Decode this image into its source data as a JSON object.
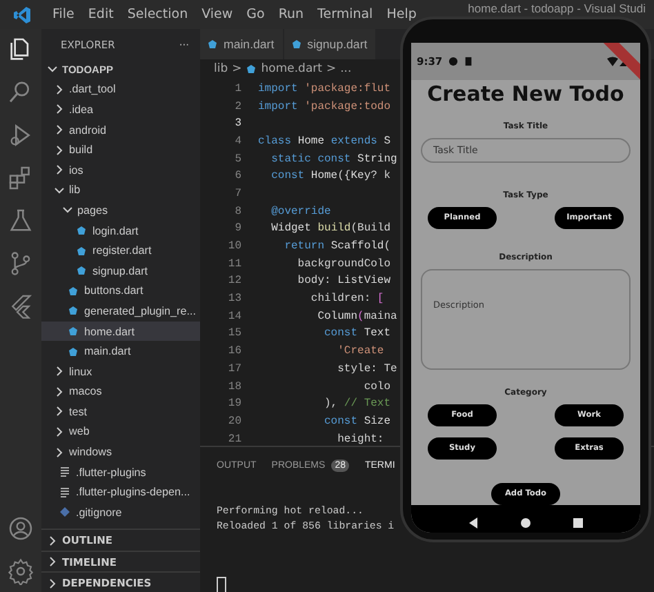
{
  "window": {
    "title": "home.dart - todoapp - Visual Studi"
  },
  "menu": [
    "File",
    "Edit",
    "Selection",
    "View",
    "Go",
    "Run",
    "Terminal",
    "Help"
  ],
  "activity_bar": [
    {
      "kind": "files",
      "selected": true
    },
    {
      "kind": "search",
      "selected": false
    },
    {
      "kind": "run",
      "selected": false
    },
    {
      "kind": "extensions",
      "selected": false
    },
    {
      "kind": "testing",
      "selected": false
    },
    {
      "kind": "source-control",
      "selected": false
    },
    {
      "kind": "flutter",
      "selected": false
    }
  ],
  "activity_bar_bottom": [
    {
      "kind": "account"
    },
    {
      "kind": "settings"
    }
  ],
  "sidebar": {
    "title": "EXPLORER",
    "more": "···",
    "root": {
      "label": "TODOAPP",
      "expanded": true,
      "children": [
        {
          "label": ".dart_tool",
          "kind": "folder",
          "expanded": false,
          "selected": false
        },
        {
          "label": ".idea",
          "kind": "folder",
          "expanded": false,
          "selected": false
        },
        {
          "label": "android",
          "kind": "folder",
          "expanded": false,
          "selected": false
        },
        {
          "label": "build",
          "kind": "folder",
          "expanded": false,
          "selected": false
        },
        {
          "label": "ios",
          "kind": "folder",
          "expanded": false,
          "selected": false
        },
        {
          "label": "lib",
          "kind": "folder",
          "expanded": true,
          "selected": false,
          "children": [
            {
              "label": "pages",
              "kind": "folder",
              "expanded": true,
              "selected": false,
              "children": [
                {
                  "label": "login.dart",
                  "kind": "dart",
                  "selected": false
                },
                {
                  "label": "register.dart",
                  "kind": "dart",
                  "selected": false
                },
                {
                  "label": "signup.dart",
                  "kind": "dart",
                  "selected": false
                }
              ]
            },
            {
              "label": "buttons.dart",
              "kind": "dart",
              "selected": false
            },
            {
              "label": "generated_plugin_re...",
              "kind": "dart",
              "selected": false
            },
            {
              "label": "home.dart",
              "kind": "dart",
              "selected": true
            },
            {
              "label": "main.dart",
              "kind": "dart",
              "selected": false
            }
          ]
        },
        {
          "label": "linux",
          "kind": "folder",
          "expanded": false,
          "selected": false
        },
        {
          "label": "macos",
          "kind": "folder",
          "expanded": false,
          "selected": false
        },
        {
          "label": "test",
          "kind": "folder",
          "expanded": false,
          "selected": false
        },
        {
          "label": "web",
          "kind": "folder",
          "expanded": false,
          "selected": false
        },
        {
          "label": "windows",
          "kind": "folder",
          "expanded": false,
          "selected": false
        },
        {
          "label": ".flutter-plugins",
          "kind": "text",
          "selected": false
        },
        {
          "label": ".flutter-plugins-depen...",
          "kind": "text",
          "selected": false
        },
        {
          "label": ".gitignore",
          "kind": "git",
          "selected": false
        }
      ]
    },
    "sections": [
      "OUTLINE",
      "TIMELINE",
      "DEPENDENCIES"
    ]
  },
  "tabs": [
    {
      "label": "main.dart",
      "selected": false
    },
    {
      "label": "signup.dart",
      "selected": false
    }
  ],
  "breadcrumb": [
    "lib",
    ">",
    "home.dart",
    ">",
    "..."
  ],
  "code": [
    {
      "n": "1",
      "current": false,
      "tokens": [
        {
          "kind": "keyword",
          "text": "import "
        },
        {
          "kind": "string",
          "text": "'package:flut"
        }
      ]
    },
    {
      "n": "2",
      "current": false,
      "tokens": [
        {
          "kind": "keyword",
          "text": "import "
        },
        {
          "kind": "string",
          "text": "'package:todo"
        }
      ]
    },
    {
      "n": "3",
      "current": true
    },
    {
      "n": "4",
      "current": false,
      "tokens": [
        {
          "kind": "keyword",
          "text": "class "
        },
        {
          "kind": "type",
          "text": "Home "
        },
        {
          "kind": "keyword",
          "text": "extends "
        },
        {
          "kind": "type",
          "text": "S"
        }
      ]
    },
    {
      "n": "5",
      "current": false,
      "tokens": [
        {
          "kind": "keyword",
          "text": "  static const "
        },
        {
          "kind": "type",
          "text": "String"
        }
      ]
    },
    {
      "n": "6",
      "current": false,
      "tokens": [
        {
          "kind": "keyword",
          "text": "  const "
        },
        {
          "kind": "type",
          "text": "Home"
        },
        {
          "kind": "plain",
          "text": "({"
        },
        {
          "kind": "type",
          "text": "Key"
        },
        {
          "kind": "plain",
          "text": "? k"
        }
      ]
    },
    {
      "n": "7",
      "current": false
    },
    {
      "n": "8",
      "current": false,
      "tokens": [
        {
          "kind": "keyword",
          "text": "  @override"
        }
      ]
    },
    {
      "n": "9",
      "current": false,
      "tokens": [
        {
          "kind": "type",
          "text": "  Widget "
        },
        {
          "kind": "function",
          "text": "build"
        },
        {
          "kind": "plain",
          "text": "(Build"
        }
      ]
    },
    {
      "n": "10",
      "current": false,
      "tokens": [
        {
          "kind": "keyword",
          "text": "    return "
        },
        {
          "kind": "type",
          "text": "Scaffold"
        },
        {
          "kind": "plain",
          "text": "("
        }
      ]
    },
    {
      "n": "11",
      "current": false,
      "tokens": [
        {
          "kind": "plain",
          "text": "      backgroundColo"
        }
      ]
    },
    {
      "n": "12",
      "current": false,
      "tokens": [
        {
          "kind": "plain",
          "text": "      body: "
        },
        {
          "kind": "type",
          "text": "ListView"
        }
      ]
    },
    {
      "n": "13",
      "current": false,
      "tokens": [
        {
          "kind": "plain",
          "text": "        children: "
        },
        {
          "kind": "bracket",
          "text": "["
        }
      ]
    },
    {
      "n": "14",
      "current": false,
      "tokens": [
        {
          "kind": "type",
          "text": "         Column"
        },
        {
          "kind": "bracket",
          "text": "("
        },
        {
          "kind": "plain",
          "text": "maina"
        }
      ]
    },
    {
      "n": "15",
      "current": false,
      "tokens": [
        {
          "kind": "keyword",
          "text": "          const "
        },
        {
          "kind": "type",
          "text": "Text"
        }
      ]
    },
    {
      "n": "16",
      "current": false,
      "tokens": [
        {
          "kind": "string",
          "text": "            'Create"
        }
      ]
    },
    {
      "n": "17",
      "current": false,
      "tokens": [
        {
          "kind": "plain",
          "text": "            style: Te"
        }
      ]
    },
    {
      "n": "18",
      "current": false,
      "tokens": [
        {
          "kind": "plain",
          "text": "                colo"
        }
      ]
    },
    {
      "n": "19",
      "current": false,
      "tokens": [
        {
          "kind": "plain",
          "text": "          ), "
        },
        {
          "kind": "comment",
          "text": "// Text"
        }
      ]
    },
    {
      "n": "20",
      "current": false,
      "tokens": [
        {
          "kind": "keyword",
          "text": "          const "
        },
        {
          "kind": "type",
          "text": "Size"
        }
      ]
    },
    {
      "n": "21",
      "current": false,
      "tokens": [
        {
          "kind": "plain",
          "text": "            height:"
        }
      ]
    }
  ],
  "panel": {
    "tabs": [
      {
        "label": "OUTPUT",
        "selected": false
      },
      {
        "label": "PROBLEMS",
        "badge": "28",
        "selected": false
      },
      {
        "label": "TERMI",
        "selected": true
      }
    ],
    "terminal": [
      "Performing hot reload...",
      "Reloaded 1 of 856 libraries i"
    ]
  },
  "phone": {
    "time": "9:37",
    "screen": {
      "title": "Create New Todo",
      "task_title": {
        "label": "Task Title",
        "placeholder": "Task Title"
      },
      "task_type": {
        "label": "Task Type",
        "options": [
          "Planned",
          "Important"
        ]
      },
      "description": {
        "label": "Description",
        "placeholder": "Description"
      },
      "category": {
        "label": "Category",
        "options": [
          "Food",
          "Work",
          "Study",
          "Extras"
        ]
      },
      "submit": "Add Todo"
    }
  }
}
